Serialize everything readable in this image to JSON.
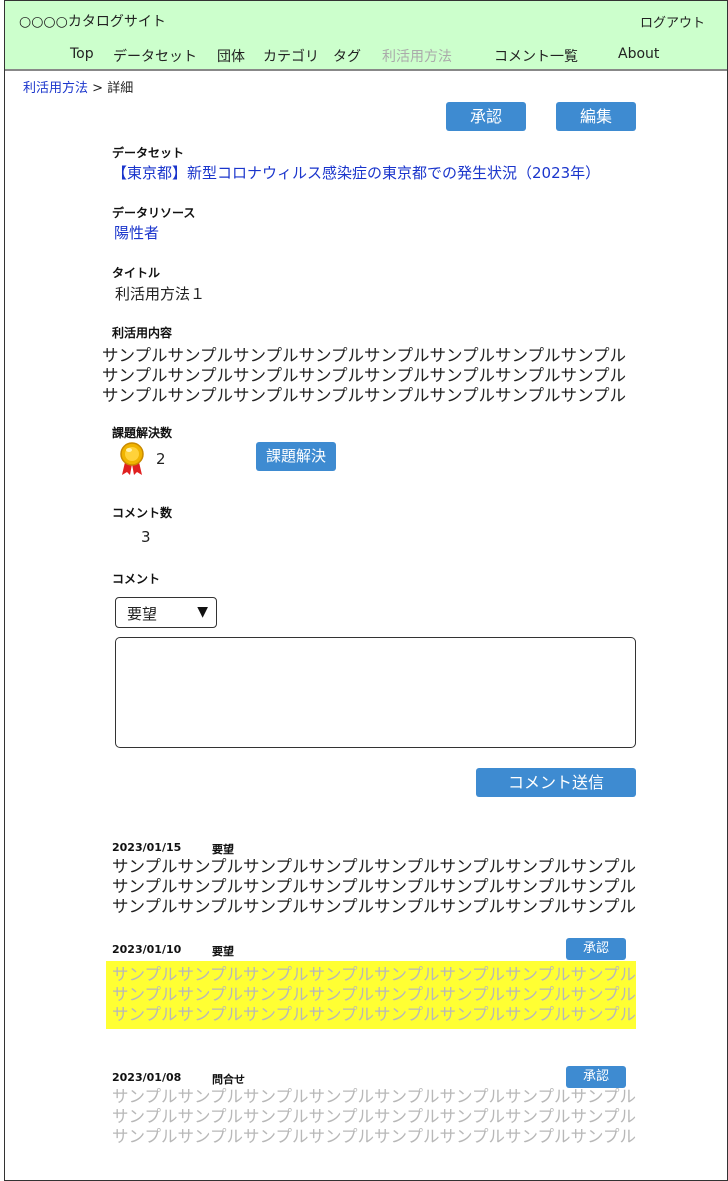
{
  "header": {
    "site_title": "○○○○カタログサイト",
    "logout": "ログアウト",
    "nav": [
      "Top",
      "データセット",
      "団体",
      "カテゴリ",
      "タグ",
      "利活用方法",
      "コメント一覧",
      "About"
    ]
  },
  "breadcrumb": {
    "parent": "利活用方法",
    "separator": " > ",
    "current": "詳細"
  },
  "actions": {
    "approve": "承認",
    "edit": "編集"
  },
  "dataset": {
    "label": "データセット",
    "value": "【東京都】新型コロナウィルス感染症の東京都での発生状況（2023年）"
  },
  "resource": {
    "label": "データリソース",
    "value": "陽性者"
  },
  "title_field": {
    "label": "タイトル",
    "value": "利活用方法１"
  },
  "content": {
    "label": "利活用内容",
    "lines": [
      "サンプルサンプルサンプルサンプルサンプルサンプルサンプルサンプル",
      "サンプルサンプルサンプルサンプルサンプルサンプルサンプルサンプル",
      "サンプルサンプルサンプルサンプルサンプルサンプルサンプルサンプル"
    ]
  },
  "solved": {
    "label": "課題解決数",
    "count": "2",
    "button": "課題解決",
    "icon": "medal-icon"
  },
  "comment_count": {
    "label": "コメント数",
    "value": "3"
  },
  "comment_form": {
    "label": "コメント",
    "type_selected": "要望",
    "caret": "▼",
    "textarea_value": "",
    "submit": "コメント送信"
  },
  "comments": [
    {
      "date": "2023/01/15",
      "type": "要望",
      "approve": "",
      "lines": [
        "サンプルサンプルサンプルサンプルサンプルサンプルサンプルサンプル",
        "サンプルサンプルサンプルサンプルサンプルサンプルサンプルサンプル",
        "サンプルサンプルサンプルサンプルサンプルサンプルサンプルサンプル"
      ]
    },
    {
      "date": "2023/01/10",
      "type": "要望",
      "approve": "承認",
      "lines": [
        "サンプルサンプルサンプルサンプルサンプルサンプルサンプルサンプル",
        "サンプルサンプルサンプルサンプルサンプルサンプルサンプルサンプル",
        "サンプルサンプルサンプルサンプルサンプルサンプルサンプルサンプル"
      ]
    },
    {
      "date": "2023/01/08",
      "type": "問合せ",
      "approve": "承認",
      "lines": [
        "サンプルサンプルサンプルサンプルサンプルサンプルサンプルサンプル",
        "サンプルサンプルサンプルサンプルサンプルサンプルサンプルサンプル",
        "サンプルサンプルサンプルサンプルサンプルサンプルサンプルサンプル"
      ]
    }
  ],
  "colors": {
    "header_bg": "#ccffcc",
    "button": "#3e8bd1",
    "link": "#1a35cc",
    "highlight": "#ffff33",
    "pending_text": "#b8b8b8"
  }
}
